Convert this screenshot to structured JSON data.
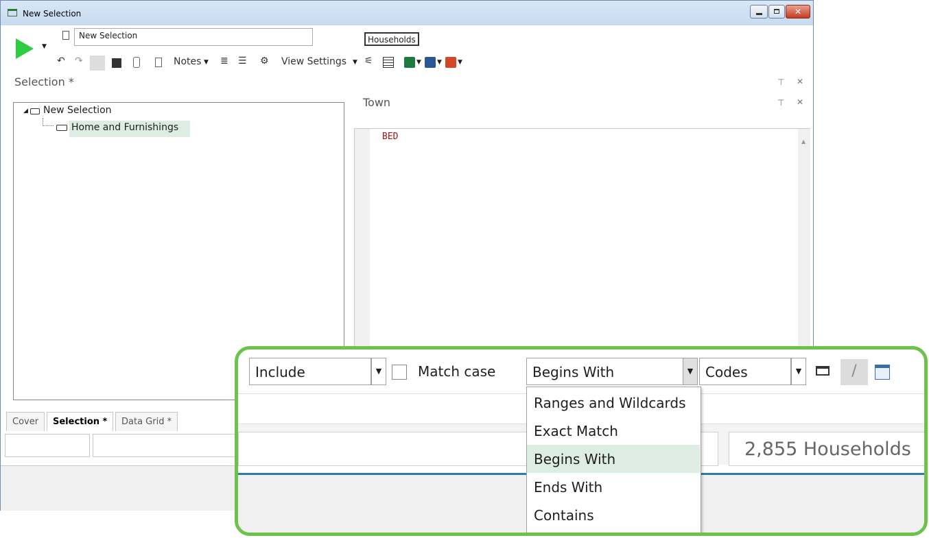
{
  "window": {
    "title": "New Selection"
  },
  "toolbar": {
    "name_value": "New Selection",
    "households_label": "Households",
    "notes_label": "Notes",
    "view_settings_label": "View Settings"
  },
  "selection_panel": {
    "title": "Selection *",
    "tree": {
      "root": "New Selection",
      "child": "Home and Furnishings"
    }
  },
  "town_panel": {
    "title": "Town",
    "editor_text": "BED"
  },
  "tabs": [
    "Cover",
    "Selection *",
    "Data Grid *"
  ],
  "callout": {
    "include_value": "Include",
    "match_case_label": "Match case",
    "match_mode_value": "Begins With",
    "codes_value": "Codes",
    "dropdown_options": [
      "Ranges and Wildcards",
      "Exact Match",
      "Begins With",
      "Ends With",
      "Contains"
    ],
    "selected_option": "Begins With",
    "status_count": "2,855 Households"
  },
  "colors": {
    "callout_border": "#6cc24a",
    "selection_highlight": "#deede3",
    "editor_text": "#a31515",
    "run_button": "#2ecc40"
  }
}
